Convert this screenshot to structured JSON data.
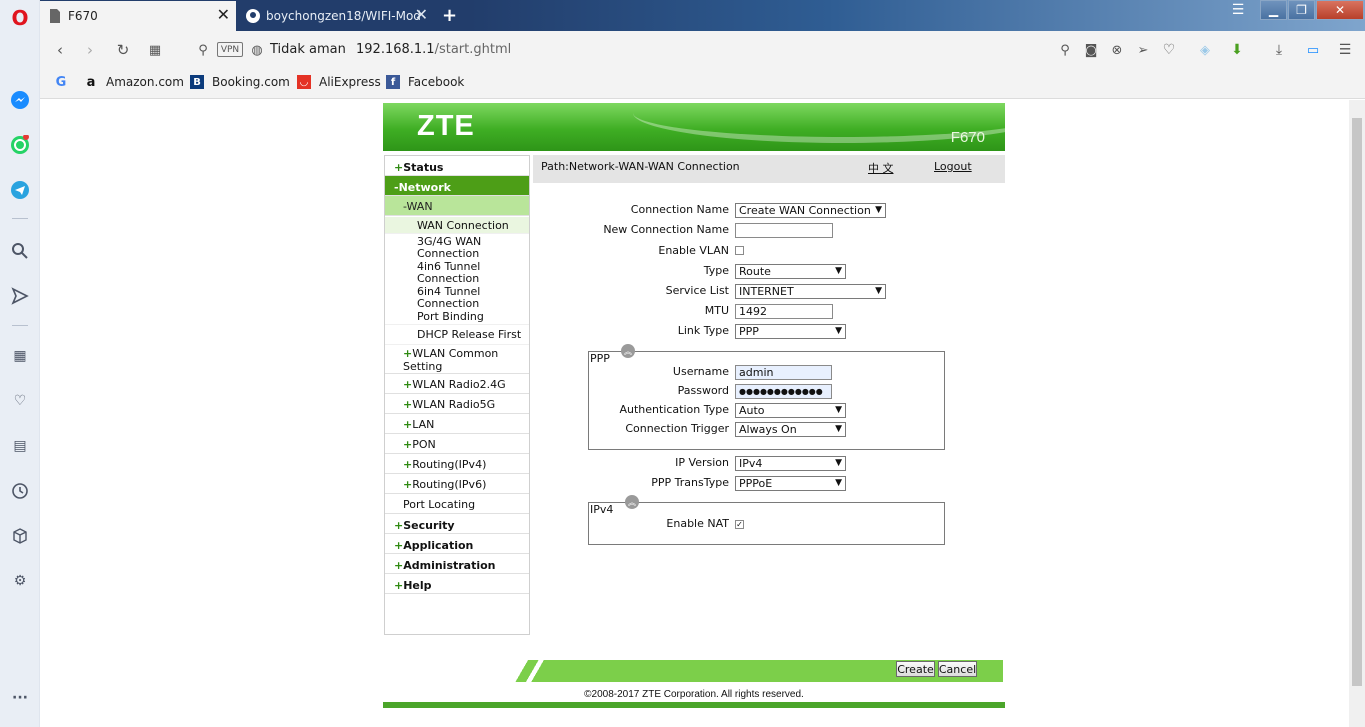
{
  "browser": {
    "tabs": [
      {
        "title": "F670"
      },
      {
        "title": "boychongzen18/WIFI-Mod"
      }
    ],
    "security_label": "Tidak aman",
    "vpn_label": "VPN",
    "url_host": "192.168.1.1",
    "url_path": "/start.ghtml",
    "bookmarks": [
      {
        "label": "Amazon.com"
      },
      {
        "label": "Booking.com"
      },
      {
        "label": "AliExpress"
      },
      {
        "label": "Facebook"
      }
    ]
  },
  "router": {
    "brand": "ZTE",
    "model": "F670",
    "nav": {
      "status": "Status",
      "network": "Network",
      "wan": "WAN",
      "wan_connection": "WAN Connection",
      "wan_3g4g": "3G/4G WAN Connection",
      "tunnel_4in6": "4in6 Tunnel Connection",
      "tunnel_6in4": "6in4 Tunnel Connection",
      "port_binding": "Port Binding",
      "dhcp_release": "DHCP Release First",
      "wlan_common": "WLAN Common Setting",
      "wlan_24": "WLAN Radio2.4G",
      "wlan_5g": "WLAN Radio5G",
      "lan": "LAN",
      "pon": "PON",
      "routing_v4": "Routing(IPv4)",
      "routing_v6": "Routing(IPv6)",
      "port_locating": "Port Locating",
      "security": "Security",
      "application": "Application",
      "administration": "Administration",
      "help": "Help"
    },
    "path": "Path:Network-WAN-WAN Connection",
    "lang": "中 文",
    "logout": "Logout",
    "form": {
      "connection_name_label": "Connection Name",
      "connection_name_value": "Create WAN Connection",
      "new_connection_name_label": "New Connection Name",
      "new_connection_name_value": "",
      "enable_vlan_label": "Enable VLAN",
      "type_label": "Type",
      "type_value": "Route",
      "service_list_label": "Service List",
      "service_list_value": "INTERNET",
      "mtu_label": "MTU",
      "mtu_value": "1492",
      "link_type_label": "Link Type",
      "link_type_value": "PPP",
      "ppp_group": "PPP",
      "username_label": "Username",
      "username_value": "admin",
      "password_label": "Password",
      "password_value": "●●●●●●●●●●●●",
      "auth_type_label": "Authentication Type",
      "auth_type_value": "Auto",
      "conn_trigger_label": "Connection Trigger",
      "conn_trigger_value": "Always On",
      "ip_version_label": "IP Version",
      "ip_version_value": "IPv4",
      "ppp_transtype_label": "PPP TransType",
      "ppp_transtype_value": "PPPoE",
      "ipv4_group": "IPv4",
      "enable_nat_label": "Enable NAT"
    },
    "buttons": {
      "create": "Create",
      "cancel": "Cancel"
    },
    "copyright": "©2008-2017 ZTE Corporation. All rights reserved."
  }
}
